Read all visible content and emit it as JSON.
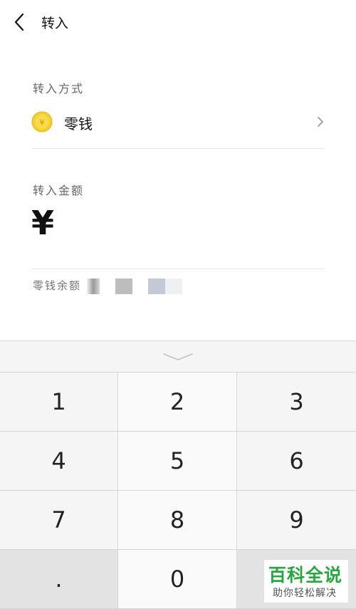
{
  "header": {
    "title": "转入"
  },
  "method": {
    "section_label": "转入方式",
    "label": "零钱"
  },
  "amount": {
    "section_label": "转入金额",
    "currency": "¥",
    "value": ""
  },
  "balance": {
    "label": "零钱余额"
  },
  "keyboard": {
    "keys": [
      "1",
      "2",
      "3",
      "4",
      "5",
      "6",
      "7",
      "8",
      "9",
      ".",
      "0",
      ""
    ]
  },
  "watermark": {
    "title": "百科全说",
    "subtitle": "助你轻松解决"
  },
  "colors": {
    "coin": "#f5cf2e",
    "watermark_green": "#27a83f"
  }
}
